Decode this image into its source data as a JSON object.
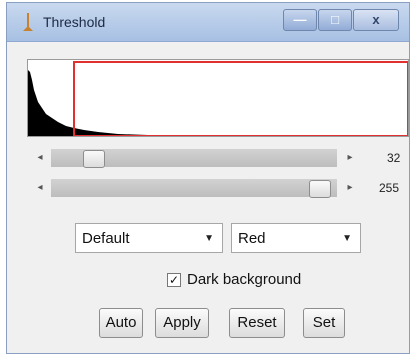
{
  "window": {
    "title": "Threshold"
  },
  "titlebar_buttons": {
    "minimize": "—",
    "maximize": "□",
    "close": "x"
  },
  "sliders": {
    "min": {
      "value": "32"
    },
    "max": {
      "value": "255"
    }
  },
  "method_dropdown": {
    "selected": "Default"
  },
  "display_dropdown": {
    "selected": "Red"
  },
  "dark_background": {
    "label": "Dark background",
    "checked": true,
    "mark": "✓"
  },
  "buttons": {
    "auto": "Auto",
    "apply": "Apply",
    "reset": "Reset",
    "set": "Set"
  },
  "icons": {
    "app": "app-icon",
    "minimize": "minimize-icon",
    "maximize": "maximize-icon",
    "close": "close-icon"
  },
  "colors": {
    "threshold_box": "#e03030",
    "histogram": "#000000"
  }
}
